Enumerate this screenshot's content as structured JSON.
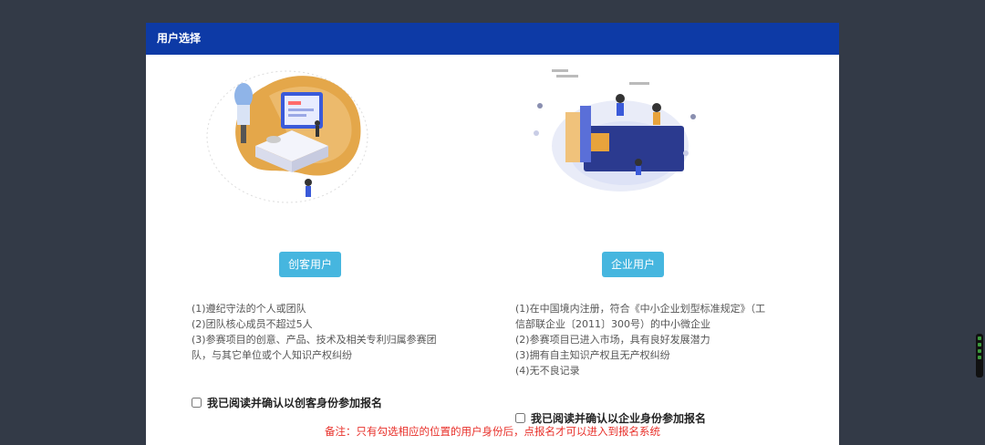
{
  "dialog": {
    "title": "用户选择"
  },
  "left": {
    "illustration_icon": "maker-team-illustration",
    "button_label": "创客用户",
    "requirements": [
      "(1)遵纪守法的个人或团队",
      "(2)团队核心成员不超过5人",
      "(3)参赛项目的创意、产品、技术及相关专利归属参赛团",
      "队，与其它单位或个人知识产权纠纷"
    ],
    "agree_label": "我已阅读并确认以创客身份参加报名"
  },
  "right": {
    "illustration_icon": "enterprise-team-illustration",
    "button_label": "企业用户",
    "requirements": [
      "(1)在中国境内注册，符合《中小企业划型标准规定》（工",
      "信部联企业〔2011〕300号）的中小微企业",
      "(2)参赛项目已进入市场，具有良好发展潜力",
      "(3)拥有自主知识产权且无产权纠纷",
      "(4)无不良记录"
    ],
    "agree_label": "我已阅读并确认以企业身份参加报名"
  },
  "note": "备注：只有勾选相应的位置的用户身份后，点报名才可以进入到报名系统",
  "colors": {
    "header": "#0d3aa6",
    "button": "#46b6df",
    "note": "#e8302a",
    "backdrop": "#333a47"
  }
}
